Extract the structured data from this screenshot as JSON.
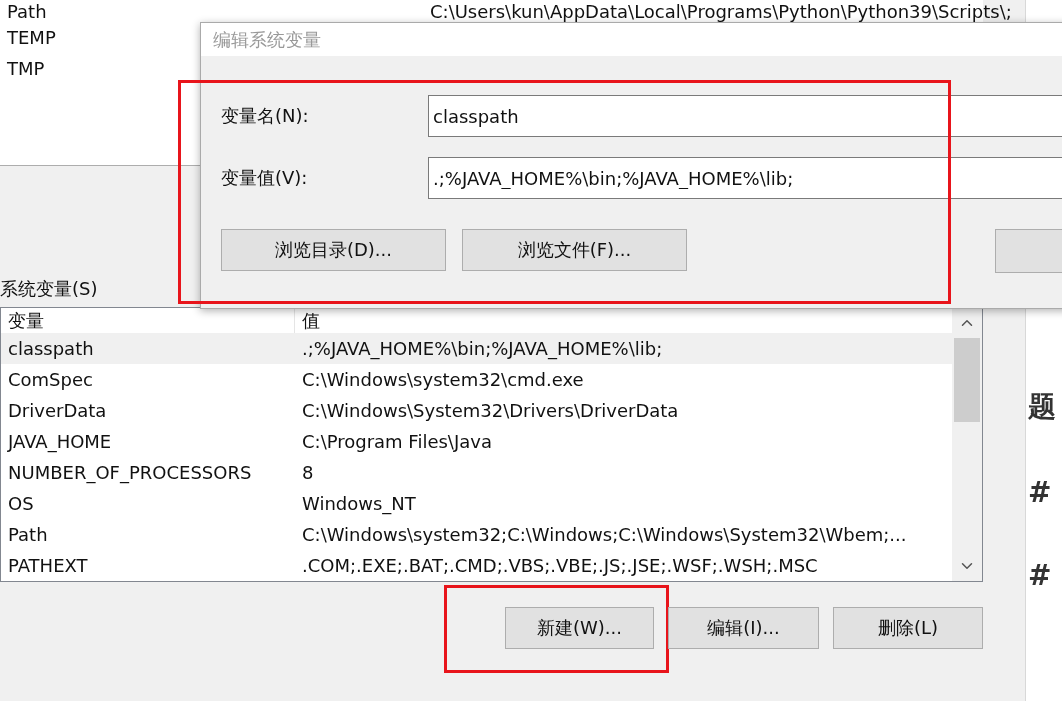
{
  "user_variables": {
    "rows": [
      {
        "name": "Path",
        "value": "C:\\Users\\kun\\AppData\\Local\\Programs\\Python\\Python39\\Scripts\\;"
      },
      {
        "name": "TEMP"
      },
      {
        "name": "TMP"
      }
    ]
  },
  "system_variables": {
    "label": "系统变量(S)",
    "columns": [
      "变量",
      "值"
    ],
    "rows": [
      {
        "name": "classpath",
        "value": ".;%JAVA_HOME%\\bin;%JAVA_HOME%\\lib;",
        "selected": true
      },
      {
        "name": "ComSpec",
        "value": "C:\\Windows\\system32\\cmd.exe",
        "selected": false
      },
      {
        "name": "DriverData",
        "value": "C:\\Windows\\System32\\Drivers\\DriverData",
        "selected": false
      },
      {
        "name": "JAVA_HOME",
        "value": "C:\\Program Files\\Java",
        "selected": false
      },
      {
        "name": "NUMBER_OF_PROCESSORS",
        "value": "8",
        "selected": false
      },
      {
        "name": "OS",
        "value": "Windows_NT",
        "selected": false
      },
      {
        "name": "Path",
        "value": "C:\\Windows\\system32;C:\\Windows;C:\\Windows\\System32\\Wbem;...",
        "selected": false
      },
      {
        "name": "PATHEXT",
        "value": ".COM;.EXE;.BAT;.CMD;.VBS;.VBE;.JS;.JSE;.WSF;.WSH;.MSC",
        "selected": false
      }
    ],
    "buttons": [
      {
        "label": "新建(W)...",
        "highlighted": true
      },
      {
        "label": "编辑(I)...",
        "highlighted": false
      },
      {
        "label": "删除(L)",
        "highlighted": false
      }
    ]
  },
  "dialog": {
    "title": "编辑系统变量",
    "highlighted": true,
    "fields": [
      {
        "label": "变量名(N):",
        "value": "classpath"
      },
      {
        "label": "变量值(V):",
        "value": ".;%JAVA_HOME%\\bin;%JAVA_HOME%\\lib;"
      }
    ],
    "buttons": [
      "浏览目录(D)...",
      "浏览文件(F)..."
    ]
  },
  "web_page": {
    "texts": [
      "题",
      "#",
      "#"
    ]
  }
}
